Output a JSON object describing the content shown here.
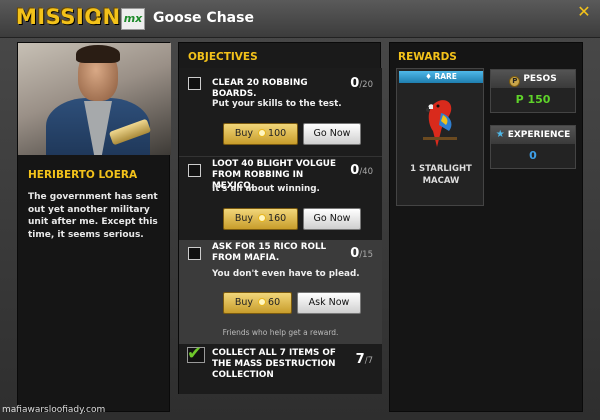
{
  "header": {
    "mission_label": "MISSION",
    "colon": ":",
    "logo_text_1": "m",
    "logo_text_2": "x",
    "mission_name": "Goose Chase",
    "close_glyph": "✕"
  },
  "character": {
    "name": "HERIBERTO LOERA",
    "description": "The government has sent out yet another military unit after me. Except this time, it seems serious."
  },
  "objectives": {
    "title": "OBJECTIVES",
    "items": [
      {
        "text": "CLEAR 20 ROBBING BOARDS.",
        "count": "0",
        "total": "/20",
        "subtitle": "Put your skills to the test.",
        "buy_label": "Buy",
        "buy_cost": "100",
        "go_label": "Go Now",
        "completed": false
      },
      {
        "text": "LOOT 40 BLIGHT VOLGUE FROM ROBBING IN MEXICO.",
        "count": "0",
        "total": "/40",
        "subtitle": "It's all about winning.",
        "buy_label": "Buy",
        "buy_cost": "160",
        "go_label": "Go Now",
        "completed": false
      },
      {
        "text": "ASK FOR 15 RICO ROLL FROM MAFIA.",
        "count": "0",
        "total": "/15",
        "subtitle": "You don't even have to plead.",
        "buy_label": "Buy",
        "buy_cost": "60",
        "go_label": "Ask Now",
        "helper": "Friends who help get a reward.",
        "completed": false
      },
      {
        "text": "COLLECT ALL 7 ITEMS OF THE MASS DESTRUCTION COLLECTION",
        "count": "7",
        "total": "/7",
        "completed": true
      }
    ]
  },
  "rewards": {
    "title": "REWARDS",
    "item": {
      "rarity": "RARE",
      "name": "1 STARLIGHT MACAW"
    },
    "pesos": {
      "label": "PESOS",
      "value": "P 150"
    },
    "experience": {
      "label": "EXPERIENCE",
      "value": "0"
    }
  },
  "watermark": "mafiawarsloofiady.com",
  "colors": {
    "accent": "#f3c21a",
    "pesos_value": "#5fd32a",
    "experience_value": "#3fa0e8",
    "rare": "#2f9ad0"
  },
  "icons": {
    "close": "close-icon",
    "coin": "coin-icon",
    "check": "check-icon",
    "pesos": "pesos-icon",
    "experience": "star-icon"
  }
}
